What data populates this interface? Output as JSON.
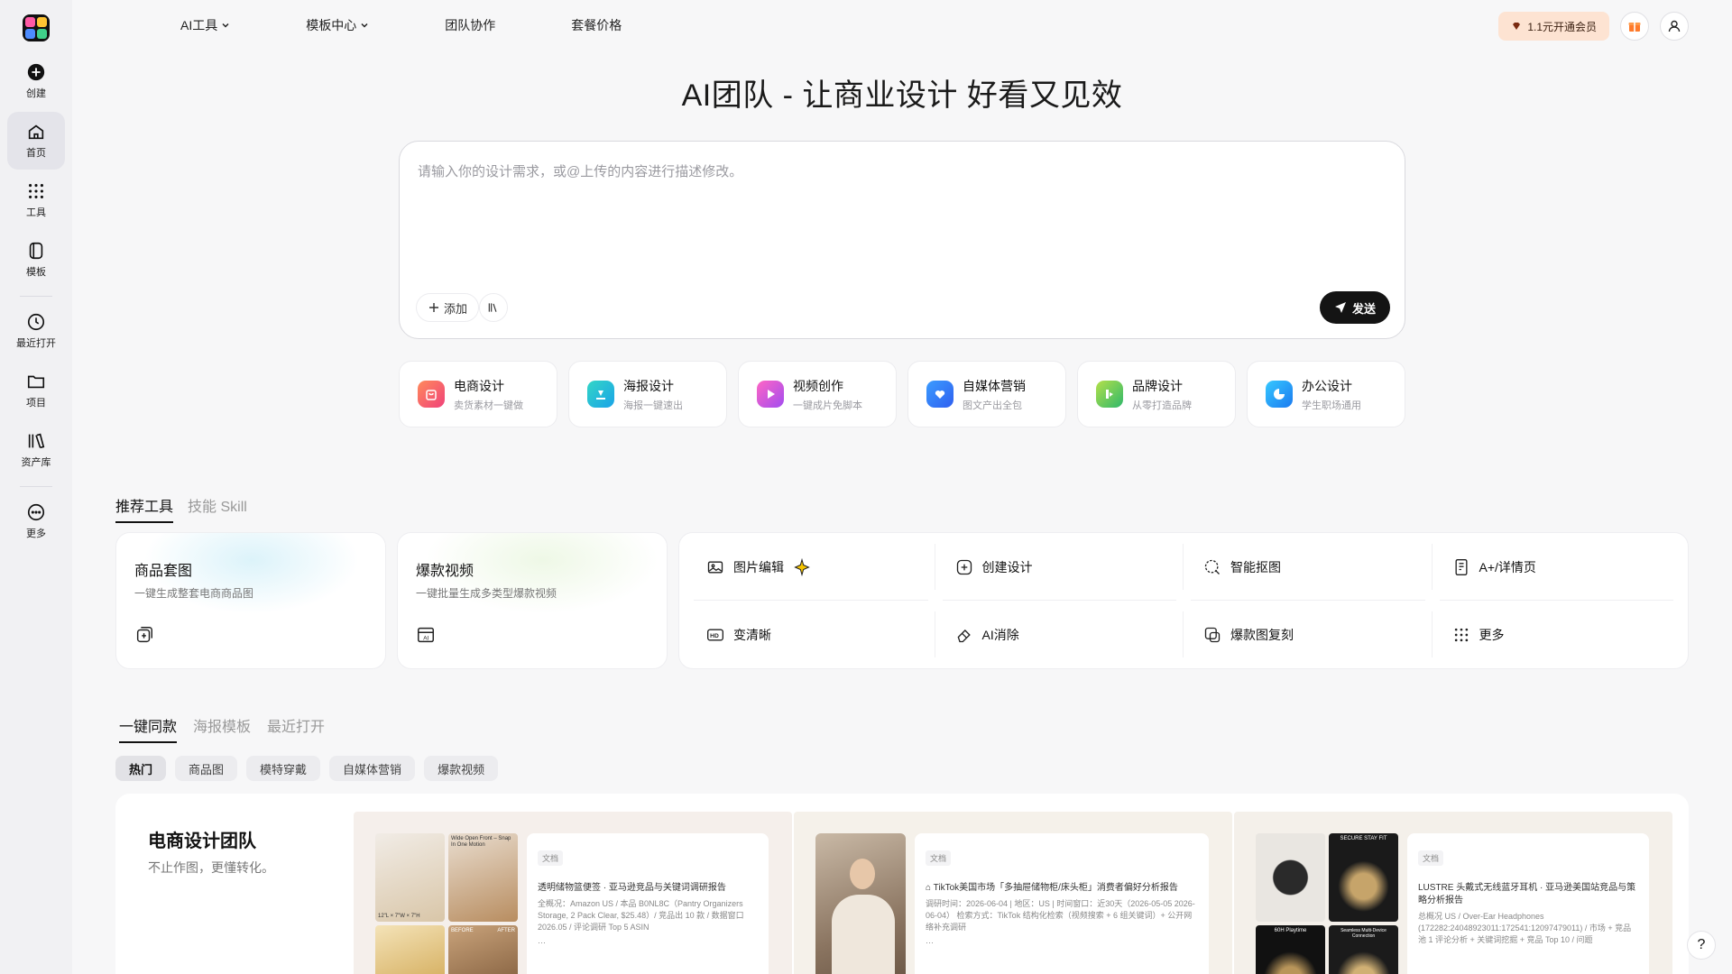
{
  "sidebar": {
    "items": [
      {
        "label": "创建"
      },
      {
        "label": "首页"
      },
      {
        "label": "工具"
      },
      {
        "label": "模板"
      },
      {
        "label": "最近打开"
      },
      {
        "label": "项目"
      },
      {
        "label": "资产库"
      },
      {
        "label": "更多"
      }
    ]
  },
  "nav": {
    "ai_tools": "AI工具",
    "templates": "模板中心",
    "team": "团队协作",
    "pricing": "套餐价格"
  },
  "topright": {
    "vip_label": "1.1元开通会员"
  },
  "hero": {
    "title": "AI团队 - 让商业设计 好看又见效",
    "placeholder": "请输入你的设计需求，或@上传的内容进行描述修改。",
    "add_label": "添加",
    "send_label": "发送"
  },
  "categories": [
    {
      "title": "电商设计",
      "sub": "卖货素材一键做",
      "color": "#f25d7d"
    },
    {
      "title": "海报设计",
      "sub": "海报一键速出",
      "color": "#1fc3b0"
    },
    {
      "title": "视频创作",
      "sub": "一键成片免脚本",
      "color": "#d040e0"
    },
    {
      "title": "自媒体营销",
      "sub": "图文产出全包",
      "color": "#2f80f0"
    },
    {
      "title": "品牌设计",
      "sub": "从零打造品牌",
      "color": "#5fc36a"
    },
    {
      "title": "办公设计",
      "sub": "学生职场通用",
      "color": "#1f9cf0"
    }
  ],
  "tools": {
    "tabs": [
      "推荐工具",
      "技能 Skill"
    ],
    "big": [
      {
        "title": "商品套图",
        "sub": "一键生成整套电商商品图"
      },
      {
        "title": "爆款视频",
        "sub": "一键批量生成多类型爆款视频"
      }
    ],
    "grid": [
      "图片编辑",
      "创建设计",
      "智能抠图",
      "A+/详情页",
      "变清晰",
      "AI消除",
      "爆款图复刻",
      "更多"
    ]
  },
  "templates": {
    "tabs": [
      "一键同款",
      "海报模板",
      "最近打开"
    ],
    "chips": [
      "热门",
      "商品图",
      "模特穿戴",
      "自媒体营销",
      "爆款视频"
    ],
    "showcase_title": "电商设计团队",
    "showcase_sub": "不止作图，更懂转化。",
    "panels": [
      {
        "tag": "文档",
        "head": "透明储物篮便签 · 亚马逊竞品与关键词调研报告",
        "body": "全概况：Amazon US / 本品 B0NL8C（Pantry Organizers Storage, 2 Pack Clear, $25.48）/ 竞品出 10 款 / 数据窗口 2026.05 / 评论调研 Top 5 ASIN",
        "more": "···"
      },
      {
        "tag": "文档",
        "head": "⌂ TikTok美国市场「多抽屉储物柜/床头柜」消费者偏好分析报告",
        "body": "调研时间：2026-06-04 | 地区：US | 时间窗口：近30天（2026-05-05 2026-06-04） 检索方式：TikTok 结构化检索（视频搜索 + 6 组关键词）+ 公开网络补充调研",
        "more": "···"
      },
      {
        "tag": "文档",
        "head": "LUSTRE 头戴式无线蓝牙耳机 · 亚马逊美国站竞品与策略分析报告",
        "body": "总概况 US / Over-Ear Headphones (172282:24048923011:172541:12097479011) / 市场 + 竞品池 1 评论分析 + 关键词挖掘 + 竞品 Top 10 / 问题",
        "more": ""
      }
    ],
    "thumb_labels": [
      "Wide Open Front – Snap In One Motion",
      "BEFORE",
      "AFTER",
      "12\"L × 7\"W × 7\"H",
      "SECURE STAY FIT",
      "60H Playtime",
      "Seamless Multi-Device Connection"
    ]
  },
  "help_label": "?"
}
